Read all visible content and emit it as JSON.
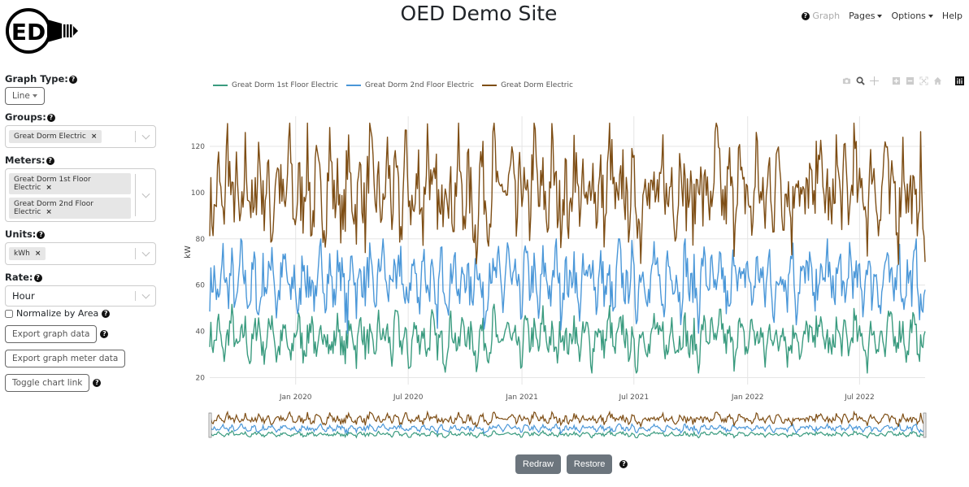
{
  "header": {
    "site_title": "OED Demo Site",
    "logo_text": "ED",
    "nav": [
      {
        "label": "Graph",
        "disabled": true,
        "has_help": true
      },
      {
        "label": "Pages",
        "dropdown": true
      },
      {
        "label": "Options",
        "dropdown": true
      },
      {
        "label": "Help"
      }
    ]
  },
  "sidebar": {
    "graph_type": {
      "label": "Graph Type:",
      "value": "Line"
    },
    "groups": {
      "label": "Groups:",
      "selected": [
        "Great Dorm Electric"
      ]
    },
    "meters": {
      "label": "Meters:",
      "selected": [
        "Great Dorm 1st Floor Electric",
        "Great Dorm 2nd Floor Electric"
      ]
    },
    "units": {
      "label": "Units:",
      "selected": [
        "kWh"
      ]
    },
    "rate": {
      "label": "Rate:",
      "value": "Hour"
    },
    "normalize": {
      "label": "Normalize by Area",
      "checked": false
    },
    "buttons": {
      "export_graph": "Export graph data",
      "export_meter": "Export graph meter data",
      "toggle_link": "Toggle chart link"
    },
    "chip_remove": "×",
    "help_glyph": "?"
  },
  "modebar": [
    "camera-icon",
    "zoom-icon",
    "pan-icon",
    "zoom-in-icon",
    "zoom-out-icon",
    "autoscale-icon",
    "reset-axes-icon",
    "plotly-logo-icon"
  ],
  "controls": {
    "redraw": "Redraw",
    "restore": "Restore"
  },
  "chart_data": {
    "type": "line",
    "title": "",
    "xlabel": "",
    "ylabel": "kW",
    "x_range": [
      "2019-08-15",
      "2022-10-15"
    ],
    "ylim": [
      17,
      133
    ],
    "y_ticks": [
      20,
      40,
      60,
      80,
      100,
      120
    ],
    "x_ticks": [
      {
        "date": "2020-01-01",
        "label": "Jan 2020"
      },
      {
        "date": "2020-07-01",
        "label": "Jul 2020"
      },
      {
        "date": "2021-01-01",
        "label": "Jan 2021"
      },
      {
        "date": "2021-07-01",
        "label": "Jul 2021"
      },
      {
        "date": "2022-01-01",
        "label": "Jan 2022"
      },
      {
        "date": "2022-07-01",
        "label": "Jul 2022"
      }
    ],
    "grid": true,
    "legend_position": "top-left",
    "range_slider": true,
    "sample_interval_days": 7,
    "series": [
      {
        "name": "Great Dorm 1st Floor Electric",
        "color": "#3a9b7f",
        "summary": {
          "min": 22,
          "max": 52,
          "mean": 37
        },
        "values": [
          40,
          33,
          44,
          28,
          38,
          46,
          31,
          36,
          42,
          27,
          39,
          45,
          30,
          37,
          48,
          29,
          35,
          41,
          26,
          38,
          44,
          32,
          36,
          47,
          24,
          39,
          43,
          31,
          35,
          45,
          28,
          37,
          42,
          30,
          46,
          33,
          38,
          27,
          44,
          36,
          40,
          29,
          47,
          34,
          38,
          25,
          43,
          35,
          41,
          30,
          45,
          33,
          37,
          28,
          44,
          39,
          31,
          46,
          34,
          40,
          27,
          42,
          36,
          32,
          48,
          29,
          38,
          43,
          33,
          37,
          26,
          44,
          35,
          40,
          31,
          46,
          34,
          39,
          28,
          42,
          37,
          33,
          45,
          30,
          38,
          41,
          27,
          43,
          36,
          34,
          47,
          29,
          39,
          44,
          32,
          36,
          25,
          42,
          38,
          31,
          45,
          35,
          40,
          28,
          46,
          33,
          37,
          43,
          30,
          39,
          26,
          44,
          36,
          41,
          32,
          47,
          34,
          38,
          29,
          43,
          37,
          31,
          45,
          35,
          40,
          27,
          42,
          38,
          33,
          46,
          30,
          36,
          44,
          28,
          39,
          41,
          32,
          48,
          35,
          37,
          29,
          43,
          34,
          40,
          31,
          45,
          36,
          38,
          27,
          44,
          33,
          41,
          30,
          47,
          35,
          39,
          42,
          28,
          46,
          37,
          32,
          40
        ]
      },
      {
        "name": "Great Dorm 2nd Floor Electric",
        "color": "#4a97d8",
        "summary": {
          "min": 38,
          "max": 80,
          "mean": 60
        },
        "values": [
          58,
          64,
          50,
          72,
          55,
          68,
          47,
          75,
          60,
          53,
          70,
          46,
          66,
          57,
          78,
          49,
          62,
          71,
          52,
          67,
          44,
          74,
          59,
          63,
          48,
          76,
          56,
          69,
          51,
          73,
          61,
          45,
          77,
          54,
          66,
          58,
          71,
          48,
          64,
          79,
          52,
          68,
          56,
          74,
          47,
          62,
          70,
          50,
          76,
          57,
          65,
          43,
          72,
          60,
          55,
          78,
          49,
          67,
          63,
          53,
          75,
          58,
          46,
          71,
          61,
          68,
          51,
          77,
          56,
          64,
          48,
          73,
          59,
          66,
          45,
          70,
          62,
          54,
          79,
          50,
          67,
          58,
          72,
          47,
          65,
          60,
          74,
          52,
          69,
          56,
          63,
          44,
          76,
          61,
          57,
          71,
          49,
          68,
          64,
          53,
          75,
          59,
          46,
          72,
          62,
          67,
          50,
          78,
          55,
          64,
          48,
          73,
          60,
          66,
          52,
          70,
          57,
          45,
          77,
          63,
          58,
          71,
          51,
          68,
          65,
          54,
          74,
          47,
          62,
          69,
          56,
          79,
          50,
          66,
          61,
          72,
          48,
          67,
          58,
          75,
          53,
          63,
          70,
          46,
          76,
          59,
          64,
          52,
          73,
          57,
          68,
          49,
          71,
          62,
          55,
          78,
          51,
          66,
          60,
          74,
          47,
          58
        ]
      },
      {
        "name": "Great Dorm Electric",
        "color": "#7e4e15",
        "summary": {
          "min": 64,
          "max": 130,
          "mean": 97
        },
        "values": [
          96,
          88,
          110,
          84,
          124,
          92,
          105,
          79,
          116,
          98,
          87,
          120,
          93,
          108,
          82,
          113,
          100,
          90,
          126,
          86,
          104,
          95,
          118,
          83,
          109,
          97,
          89,
          121,
          94,
          106,
          80,
          115,
          99,
          91,
          112,
          85,
          123,
          96,
          102,
          88,
          117,
          93,
          107,
          81,
          119,
          98,
          90,
          111,
          86,
          125,
          94,
          103,
          84,
          114,
          100,
          92,
          120,
          87,
          108,
          95,
          79,
          116,
          99,
          89,
          122,
          91,
          105,
          97,
          113,
          83,
          110,
          96,
          88,
          127,
          93,
          104,
          86,
          118,
          98,
          91,
          109,
          82,
          121,
          95,
          101,
          89,
          115,
          92,
          107,
          84,
          124,
          97,
          90,
          112,
          87,
          106,
          99,
          80,
          119,
          94,
          103,
          88,
          116,
          91,
          111,
          85,
          122,
          96,
          100,
          89,
          114,
          93,
          108,
          83,
          126,
          98,
          92,
          110,
          86,
          117,
          95,
          104,
          81,
          120,
          97,
          90,
          113,
          88,
          123,
          94,
          106,
          85,
          115,
          99,
          91,
          109,
          87,
          128,
          96,
          102,
          84,
          118,
          93,
          111,
          89,
          121,
          95,
          105,
          86,
          116,
          98,
          90,
          124,
          92,
          107,
          83,
          119,
          96,
          101,
          88,
          112,
          70
        ]
      }
    ]
  }
}
